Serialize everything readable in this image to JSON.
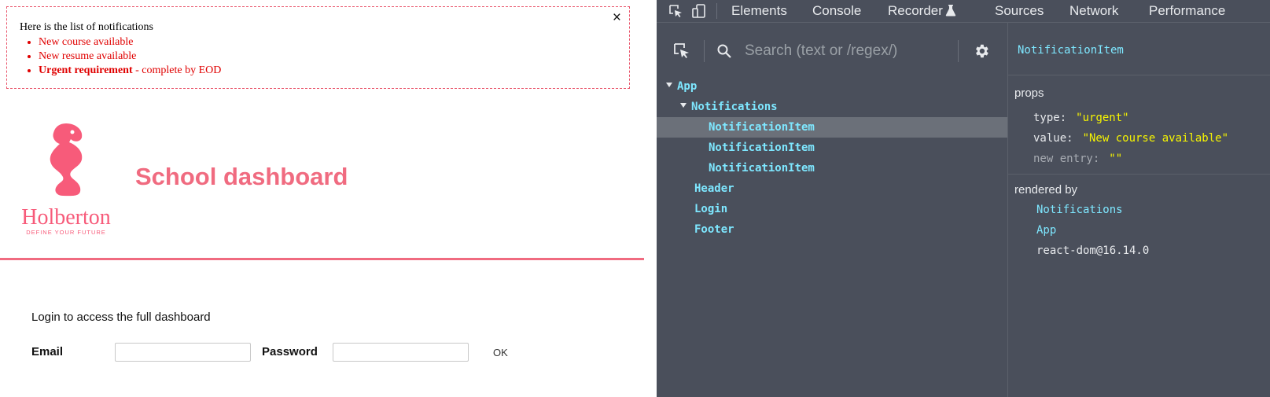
{
  "notifications": {
    "intro": "Here is the list of notifications",
    "close_icon": "×",
    "items": [
      {
        "text": "New course available"
      },
      {
        "text": "New resume available"
      },
      {
        "strong": "Urgent requirement",
        "text": " - complete by EOD"
      }
    ]
  },
  "header": {
    "logo_text": "Holberton",
    "logo_tagline": "DEFINE YOUR FUTURE",
    "title": "School dashboard",
    "accent": "#f06b80"
  },
  "login": {
    "text": "Login to access the full dashboard",
    "email_label": "Email",
    "email_value": "",
    "password_label": "Password",
    "password_value": "",
    "ok_label": "OK"
  },
  "devtools": {
    "tabs": [
      "Elements",
      "Console",
      "Recorder",
      "Sources",
      "Network",
      "Performance"
    ],
    "search_placeholder": "Search (text or /regex/)",
    "tree": [
      {
        "label": "App",
        "depth": 0,
        "expanded": true
      },
      {
        "label": "Notifications",
        "depth": 1,
        "expanded": true
      },
      {
        "label": "NotificationItem",
        "depth": 2,
        "selected": true
      },
      {
        "label": "NotificationItem",
        "depth": 2
      },
      {
        "label": "NotificationItem",
        "depth": 2
      },
      {
        "label": "Header",
        "depth": 1
      },
      {
        "label": "Login",
        "depth": 1
      },
      {
        "label": "Footer",
        "depth": 1
      }
    ],
    "selected_component": "NotificationItem",
    "props_heading": "props",
    "props": [
      {
        "key": "type:",
        "value": "\"urgent\""
      },
      {
        "key": "value:",
        "value": "\"New course available\""
      },
      {
        "key": "new entry:",
        "value": "\"\""
      }
    ],
    "rendered_by_heading": "rendered by",
    "rendered_by": [
      {
        "label": "Notifications",
        "link": true
      },
      {
        "label": "App",
        "link": true
      },
      {
        "label": "react-dom@16.14.0",
        "link": false
      }
    ],
    "colors": {
      "panel_bg": "#4a4f5b",
      "component": "#7ee7ff",
      "string": "#f7f500"
    }
  }
}
